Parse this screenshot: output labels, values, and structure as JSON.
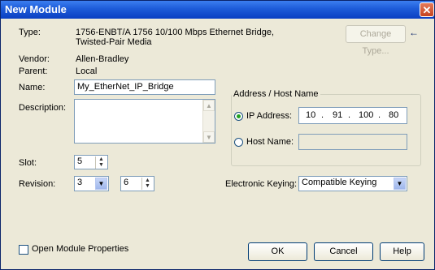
{
  "window": {
    "title": "New Module",
    "close": "✕"
  },
  "labels": {
    "type": "Type:",
    "vendor": "Vendor:",
    "parent": "Parent:",
    "name": "Name:",
    "description": "Description:",
    "slot": "Slot:",
    "revision": "Revision:",
    "electronic_keying": "Electronic Keying:"
  },
  "values": {
    "type_line1": "1756-ENBT/A 1756 10/100 Mbps Ethernet Bridge,",
    "type_line2": "Twisted-Pair Media",
    "vendor": "Allen-Bradley",
    "parent": "Local",
    "name": "My_EtherNet_IP_Bridge",
    "description": "",
    "slot": "5",
    "revision_major": "3",
    "revision_minor": "6",
    "electronic_keying": "Compatible Keying"
  },
  "address_group": {
    "title": "Address / Host Name",
    "ip_label": "IP Address:",
    "ip_octets": [
      "10",
      "91",
      "100",
      "80"
    ],
    "host_label": "Host Name:",
    "host_value": "",
    "selected": "ip"
  },
  "buttons": {
    "change_type": "Change Type...",
    "ok": "OK",
    "cancel": "Cancel",
    "help": "Help"
  },
  "open_module_properties": {
    "label": "Open Module Properties",
    "checked": false
  },
  "icons": {
    "arrow": "arrow-left-icon"
  },
  "colors": {
    "title_bar": "#1d5bd8",
    "dialog_bg": "#ece9d8"
  }
}
